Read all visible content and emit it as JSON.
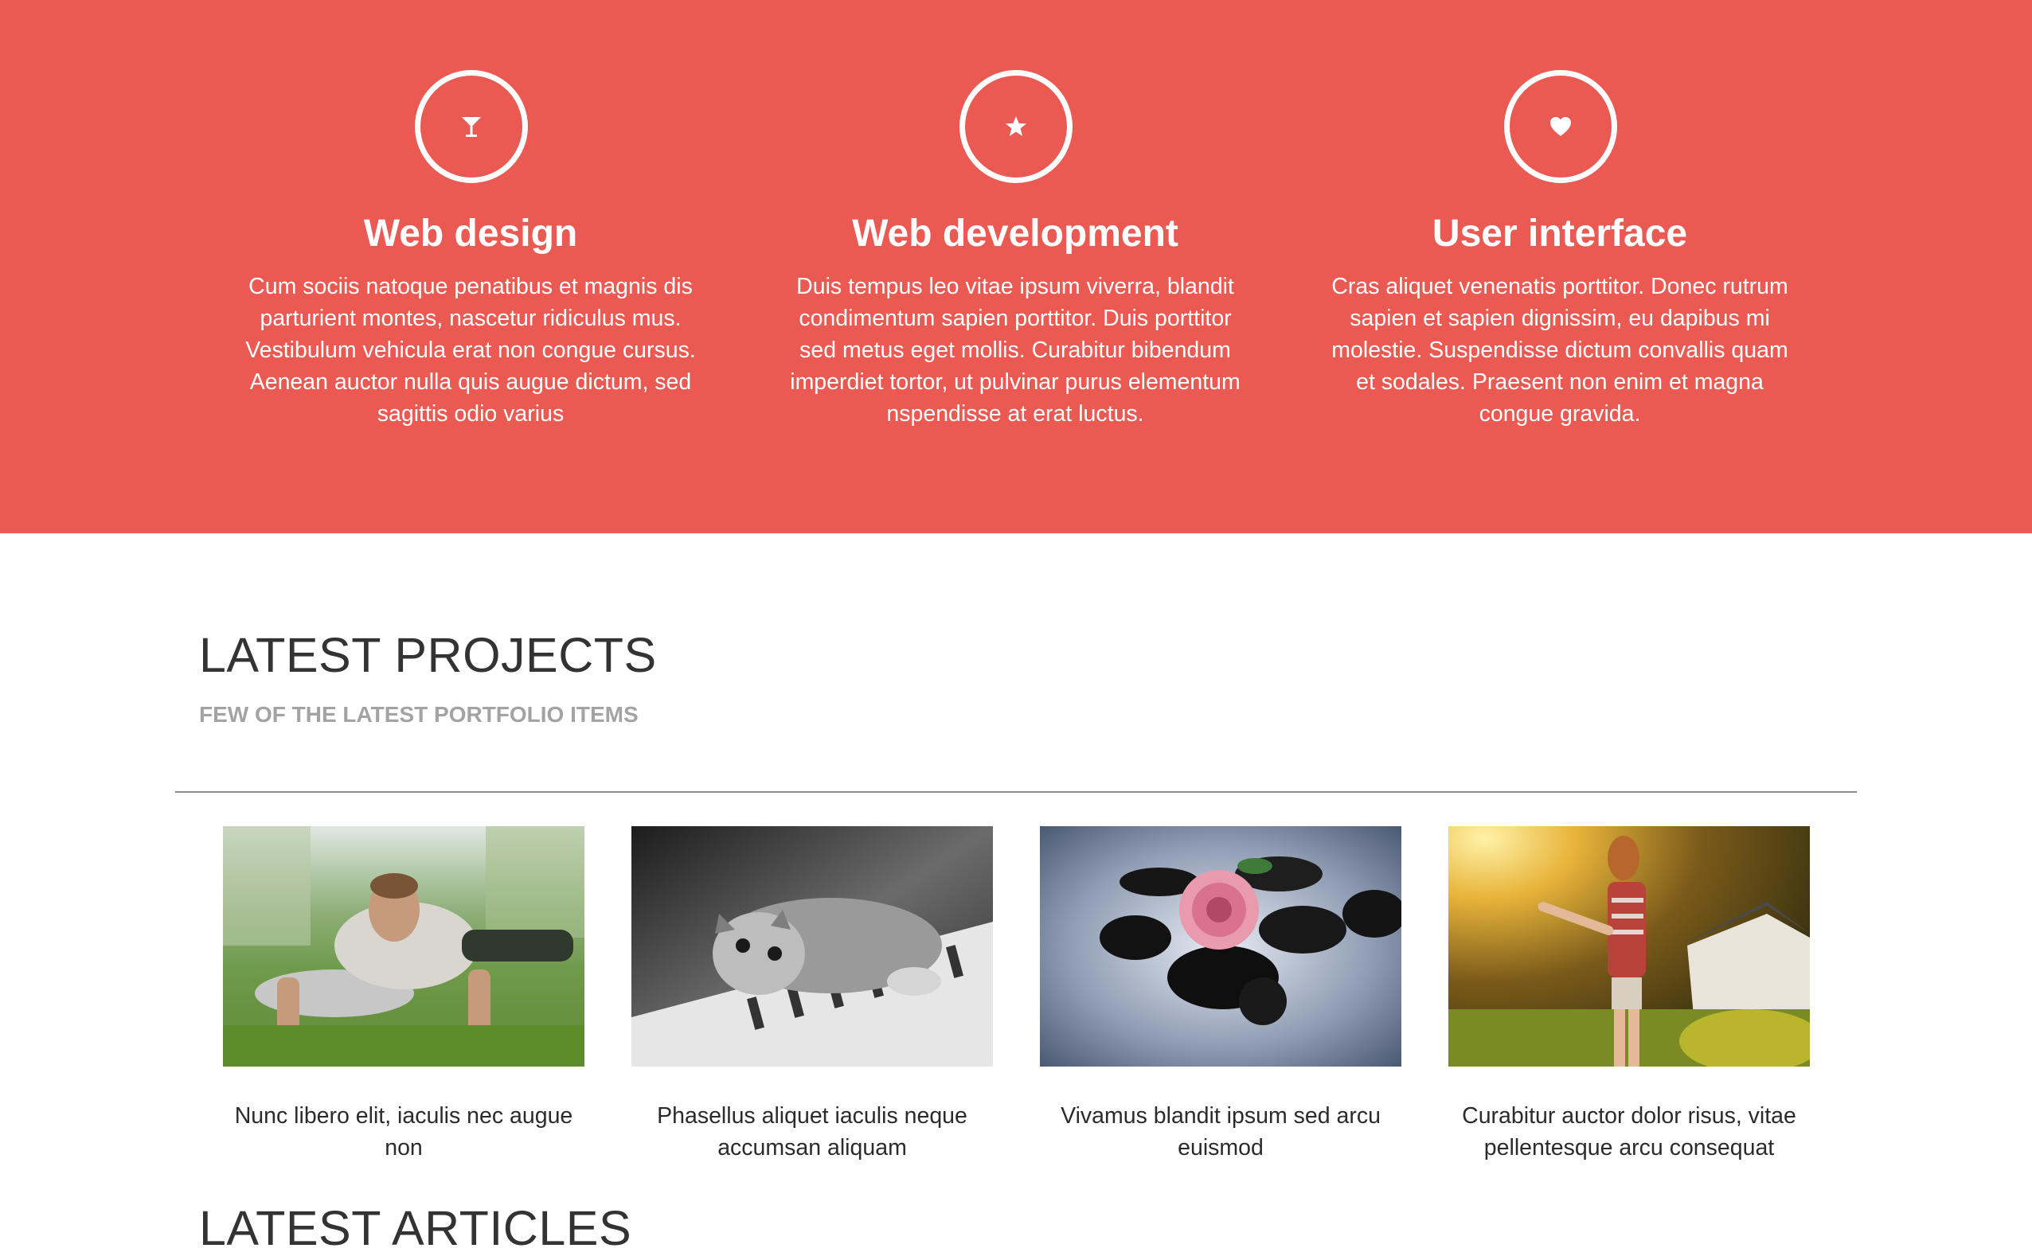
{
  "colors": {
    "services_background": "#eb5a52",
    "services_text": "#ffffff",
    "heading_text": "#333333",
    "subtitle_text": "#a3a3a3",
    "divider": "#8c8c8c"
  },
  "services": [
    {
      "icon": "cocktail-glass-icon",
      "title": "Web design",
      "text": "Cum sociis natoque penatibus et magnis dis parturient montes, nascetur ridiculus mus. Vestibulum vehicula erat non congue cursus. Aenean auctor nulla quis augue dictum, sed sagittis odio varius"
    },
    {
      "icon": "star-icon",
      "title": "Web development",
      "text": "Duis tempus leo vitae ipsum viverra, blandit condimentum sapien porttitor. Duis porttitor sed metus eget mollis. Curabitur bibendum imperdiet tortor, ut pulvinar purus elementum nspendisse at erat luctus."
    },
    {
      "icon": "heart-icon",
      "title": "User interface",
      "text": "Cras aliquet venenatis porttitor. Donec rutrum sapien et sapien dignissim, eu dapibus mi molestie. Suspendisse dictum convallis quam et sodales. Praesent non enim et magna congue gravida."
    }
  ],
  "projects_section": {
    "title": "LATEST PROJECTS",
    "subtitle": "FEW OF THE LATEST PORTFOLIO ITEMS",
    "items": [
      {
        "image": "man-doing-pushups-photo",
        "caption": "Nunc libero elit, iaculis nec augue non"
      },
      {
        "image": "kitten-on-piano-photo",
        "caption": "Phasellus aliquet iaculis neque accumsan aliquam"
      },
      {
        "image": "rose-on-stones-photo",
        "caption": "Vivamus blandit ipsum sed arcu euismod"
      },
      {
        "image": "woman-in-sunlight-photo",
        "caption": "Curabitur auctor dolor risus, vitae pellentesque arcu consequat"
      }
    ]
  },
  "articles_section": {
    "title": "LATEST ARTICLES"
  }
}
